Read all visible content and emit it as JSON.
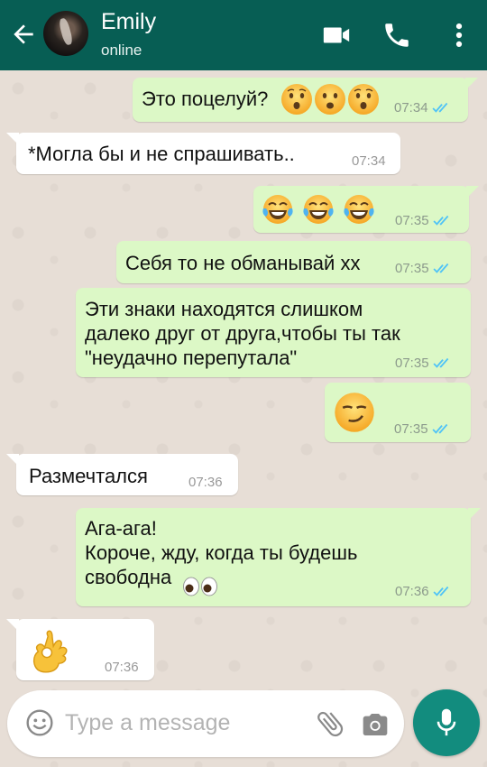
{
  "header": {
    "contact_name": "Emily",
    "status": "online",
    "bg_color": "#075e54",
    "icons": [
      "back-arrow-icon",
      "video-call-icon",
      "phone-icon",
      "more-options-icon"
    ]
  },
  "messages": [
    {
      "dir": "out",
      "text": "Это поцелуй?",
      "emoji": [
        "hushed-face",
        "frowning-face",
        "hushed-face"
      ],
      "time": "07:34",
      "status": "read"
    },
    {
      "dir": "in",
      "text": "*Могла бы и не спрашивать..",
      "time": "07:34"
    },
    {
      "dir": "out",
      "text": "",
      "emoji": [
        "tears-of-joy-face",
        "tears-of-joy-face",
        "tears-of-joy-face"
      ],
      "time": "07:35",
      "status": "read"
    },
    {
      "dir": "out",
      "text": "Себя то не обманывай хх",
      "time": "07:35",
      "status": "read"
    },
    {
      "dir": "out",
      "text": "Эти знаки находятся слишком\nдалеко друг от друга,чтобы ты так\n\"неудачно перепутала\"",
      "time": "07:35",
      "status": "read"
    },
    {
      "dir": "out",
      "text": "",
      "emoji": [
        "smirking-face"
      ],
      "time": "07:35",
      "status": "read"
    },
    {
      "dir": "in",
      "text": "Размечтался",
      "time": "07:36"
    },
    {
      "dir": "out",
      "text": "Ага-ага!\nКороче, жду, когда ты будешь\nсвободна",
      "emoji": [
        "eyes"
      ],
      "time": "07:36",
      "status": "read"
    },
    {
      "dir": "in",
      "text": "",
      "emoji": [
        "ok-hand"
      ],
      "time": "07:36"
    }
  ],
  "input": {
    "placeholder": "Type a message",
    "icons": [
      "emoji-icon",
      "attach-icon",
      "camera-icon",
      "mic-icon"
    ]
  },
  "colors": {
    "outgoing_bubble": "#dcf8c6",
    "incoming_bubble": "#ffffff",
    "read_ticks": "#4fc3f7",
    "mic_button": "#128c7e"
  }
}
